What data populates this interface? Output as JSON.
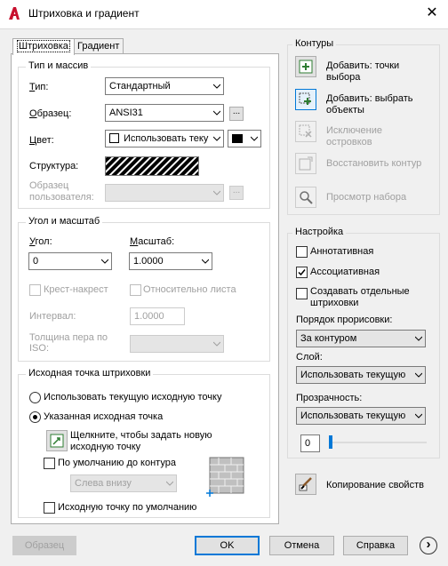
{
  "window": {
    "title": "Штриховка и градиент",
    "close_symbol": "✕"
  },
  "tabs": [
    {
      "label": "Штриховка",
      "active": true
    },
    {
      "label": "Градиент",
      "active": false
    }
  ],
  "type_pattern": {
    "group_title": "Тип и массив",
    "type_label": "Тип:",
    "type_value": "Стандартный",
    "pattern_label": "Образец:",
    "pattern_value": "ANSI31",
    "browse_label": "...",
    "color_label": "Цвет:",
    "color_value": "Использовать теку",
    "color_swatch": "#000000",
    "structure_label": "Структура:",
    "user_pattern_label_line1": "Образец",
    "user_pattern_label_line2": "пользователя:"
  },
  "angle_scale": {
    "group_title": "Угол и масштаб",
    "angle_label": "Угол:",
    "angle_value": "0",
    "scale_label": "Масштаб:",
    "scale_value": "1.0000",
    "double_label": "Крест-накрест",
    "relative_label": "Относительно листа",
    "spacing_label": "Интервал:",
    "spacing_value": "1.0000",
    "pen_width_label_line1": "Толщина пера по",
    "pen_width_label_line2": "ISO:"
  },
  "origin": {
    "group_title": "Исходная точка штриховки",
    "use_current_label": "Использовать текущую исходную точку",
    "specified_label": "Указанная исходная точка",
    "specified_selected": true,
    "click_label_line1": "Щелкните, чтобы задать новую",
    "click_label_line2": "исходную точку",
    "default_boundary_label": "По умолчанию до контура",
    "position_value": "Слева внизу",
    "store_default_label": "Исходную точку по умолчанию"
  },
  "boundaries": {
    "group_title": "Контуры",
    "add_pick_line1": "Добавить: точки",
    "add_pick_line2": "выбора",
    "add_select_line1": "Добавить: выбрать",
    "add_select_line2": "объекты",
    "remove_line1": "Исключение",
    "remove_line2": "островков",
    "recreate_label": "Восстановить контур",
    "view_label": "Просмотр набора"
  },
  "options": {
    "group_title": "Настройка",
    "annotative_label": "Аннотативная",
    "annotative_checked": false,
    "associative_label": "Ассоциативная",
    "associative_checked": true,
    "separate_line1": "Создавать отдельные",
    "separate_line2": "штриховки",
    "separate_checked": false,
    "draw_order_label": "Порядок прорисовки:",
    "draw_order_value": "За контуром",
    "layer_label": "Слой:",
    "layer_value": "Использовать текущую",
    "transparency_label": "Прозрачность:",
    "transparency_value": "Использовать текущую",
    "transparency_amount": "0"
  },
  "inherit_label": "Копирование свойств",
  "footer": {
    "preview_label": "Образец",
    "ok_label": "OK",
    "cancel_label": "Отмена",
    "help_label": "Справка",
    "more_symbol": "›"
  },
  "colors": {
    "accent": "#0078d7",
    "app_red": "#c8102e",
    "slider": "#0078d7"
  }
}
